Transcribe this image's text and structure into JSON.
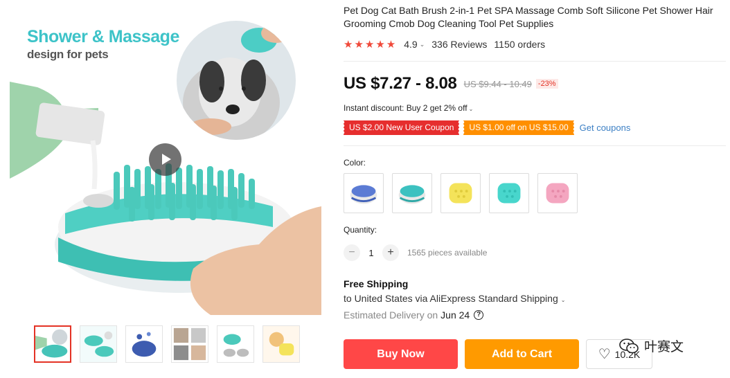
{
  "gallery": {
    "hero_title": "Shower & Massage",
    "hero_subtitle": "design for pets",
    "thumbnails": [
      "thumb-1",
      "thumb-2",
      "thumb-3",
      "thumb-4",
      "thumb-5",
      "thumb-6"
    ],
    "active_thumbnail": 0,
    "play_icon": "play-icon"
  },
  "product": {
    "title": "Pet Dog Cat Bath Brush 2-in-1 Pet SPA Massage Comb Soft Silicone Pet Shower Hair Grooming Cmob Dog Cleaning Tool Pet Supplies",
    "rating": "4.9",
    "stars": "★★★★★",
    "reviews": "336 Reviews",
    "orders": "1150 orders"
  },
  "pricing": {
    "price": "US $7.27 - 8.08",
    "original_price": "US $9.44 - 10.49",
    "discount": "-23%",
    "instant_discount": "Instant discount: Buy 2 get 2% off",
    "coupons": [
      "US $2.00 New User Coupon",
      "US $1.00 off on US $15.00"
    ],
    "get_coupons": "Get coupons"
  },
  "options": {
    "color_label": "Color:",
    "colors": [
      {
        "name": "blue-white",
        "hex": "#5b7bd4"
      },
      {
        "name": "teal-white",
        "hex": "#3cc1c0"
      },
      {
        "name": "yellow",
        "hex": "#f4e35a"
      },
      {
        "name": "mint",
        "hex": "#48d6cc"
      },
      {
        "name": "pink",
        "hex": "#f4a6c0"
      }
    ],
    "quantity_label": "Quantity:",
    "quantity": "1",
    "available": "1565 pieces available"
  },
  "shipping": {
    "title": "Free Shipping",
    "line": "to United States via AliExpress Standard Shipping",
    "delivery_label": "Estimated Delivery on",
    "delivery_date": "Jun 24"
  },
  "actions": {
    "buy_now": "Buy Now",
    "add_to_cart": "Add to Cart",
    "wishlist_count": "10.2K"
  },
  "watermark": "叶赛文",
  "colors": {
    "accent_red": "#ff4747",
    "accent_orange": "#ff9a00",
    "star_red": "#f0493a",
    "brand_teal": "#3dc3c8",
    "link_blue": "#3b7fc4"
  }
}
